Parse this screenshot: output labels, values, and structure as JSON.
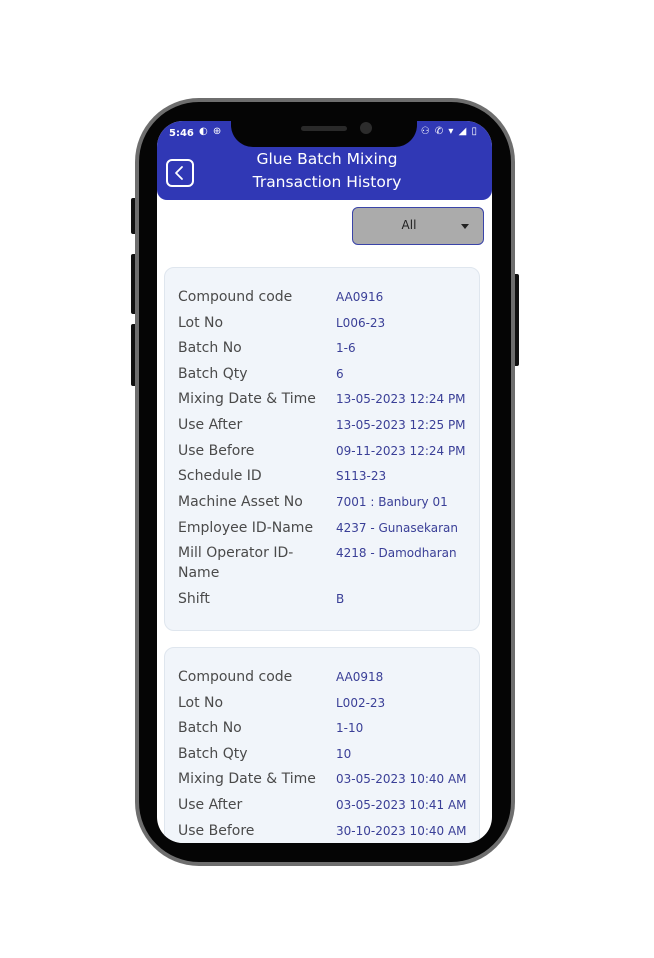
{
  "status_bar": {
    "time": "5:46",
    "left_icons": "◐ ⊕",
    "right_icons": "⚇ ✆ ▾ ◢ ▯"
  },
  "header": {
    "back_icon": "chevron-left",
    "title_line1": "Glue Batch Mixing",
    "title_line2": "Transaction History"
  },
  "filter": {
    "selected": "All"
  },
  "colors": {
    "primary": "#3038b5",
    "value_text": "#3a3f97",
    "card_bg": "#f1f5fa"
  },
  "records": [
    {
      "rows": [
        {
          "label": "Compound code",
          "value": "AA0916"
        },
        {
          "label": "Lot No",
          "value": "L006-23"
        },
        {
          "label": "Batch No",
          "value": "1-6"
        },
        {
          "label": "Batch Qty",
          "value": "6"
        },
        {
          "label": "Mixing Date & Time",
          "value": "13-05-2023 12:24 PM"
        },
        {
          "label": "Use After",
          "value": "13-05-2023 12:25 PM"
        },
        {
          "label": "Use Before",
          "value": "09-11-2023 12:24 PM"
        },
        {
          "label": "Schedule ID",
          "value": "S113-23"
        },
        {
          "label": "Machine Asset No",
          "value": "7001 : Banbury 01"
        },
        {
          "label": "Employee ID-Name",
          "value": "4237 - Gunasekaran"
        },
        {
          "label": "Mill Operator ID-Name",
          "value": "4218 - Damodharan"
        },
        {
          "label": "Shift",
          "value": "B"
        }
      ]
    },
    {
      "rows": [
        {
          "label": "Compound code",
          "value": "AA0918"
        },
        {
          "label": "Lot No",
          "value": "L002-23"
        },
        {
          "label": "Batch No",
          "value": "1-10"
        },
        {
          "label": "Batch Qty",
          "value": "10"
        },
        {
          "label": "Mixing Date & Time",
          "value": "03-05-2023 10:40 AM"
        },
        {
          "label": "Use After",
          "value": "03-05-2023 10:41 AM"
        },
        {
          "label": "Use Before",
          "value": "30-10-2023 10:40 AM"
        }
      ]
    }
  ]
}
